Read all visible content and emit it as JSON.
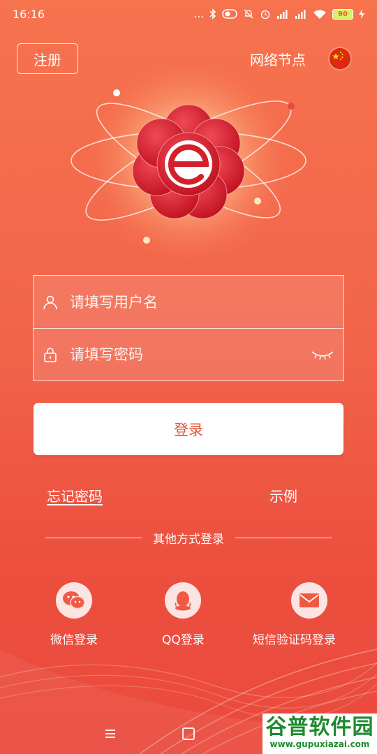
{
  "status_bar": {
    "time": "16:16",
    "dots": "...",
    "battery": "90"
  },
  "header": {
    "register_label": "注册",
    "node_label": "网络节点"
  },
  "form": {
    "username_placeholder": "请填写用户名",
    "password_placeholder": "请填写密码"
  },
  "login_label": "登录",
  "links": {
    "forgot_password": "忘记密码",
    "example": "示例"
  },
  "divider_text": "其他方式登录",
  "social": [
    {
      "label": "微信登录",
      "icon": "wechat-icon"
    },
    {
      "label": "QQ登录",
      "icon": "qq-icon"
    },
    {
      "label": "短信验证码登录",
      "icon": "mail-icon"
    }
  ],
  "watermark": {
    "logo_text": "谷普软件园",
    "url": "www.gupuxiazai.com"
  },
  "colors": {
    "background_top": "#f6734e",
    "background_bottom": "#ea4a3d",
    "login_text": "#e0553e",
    "watermark_green": "#1e8a2e"
  }
}
